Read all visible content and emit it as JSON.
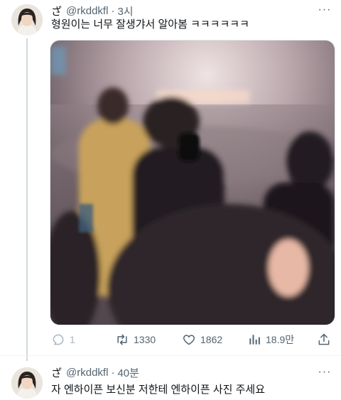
{
  "tweets": [
    {
      "handle_prefix": "ざ",
      "handle": "@rkddkfl",
      "separator": "·",
      "time": "3시",
      "text": "형원이는 너무 잘생갸서 알아봄 ㅋㅋㅋㅋㅋㅋ",
      "more": "···",
      "actions": {
        "reply_count": "1",
        "retweet_count": "1330",
        "like_count": "1862",
        "view_count": "18.9만"
      }
    },
    {
      "handle_prefix": "ざ",
      "handle": "@rkddkfl",
      "separator": "·",
      "time": "40분",
      "text": "자 엔하이픈 보신분 저한테 엔하이픈 사진 주세요",
      "more": "···"
    }
  ],
  "icons": {
    "reply": "reply-icon",
    "retweet": "retweet-icon",
    "like": "heart-icon",
    "views": "views-icon",
    "share": "share-icon"
  }
}
